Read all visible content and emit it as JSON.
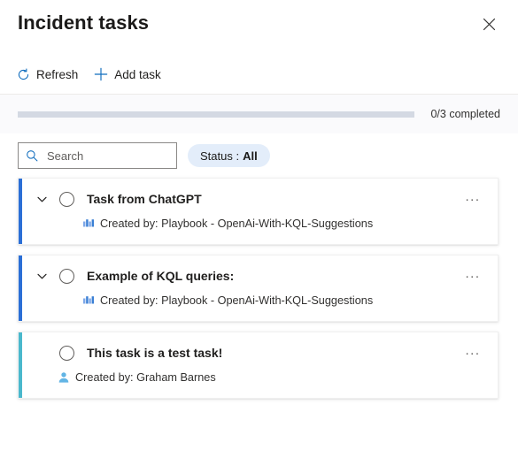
{
  "header": {
    "title": "Incident tasks",
    "close_label": "Close",
    "close_icon": "close-icon"
  },
  "command_bar": {
    "items": [
      {
        "label": "Refresh",
        "icon": "refresh-icon",
        "name": "refresh"
      },
      {
        "label": "Add task",
        "icon": "plus-icon",
        "name": "add-task"
      }
    ]
  },
  "progress": {
    "completed": 0,
    "total": 3,
    "percent": 0,
    "label": "0/3 completed",
    "track_color": "#d4d9e3",
    "fill_color": "#0f6cbd"
  },
  "filters": {
    "search": {
      "placeholder": "Search",
      "value": "",
      "icon": "search-icon"
    },
    "status_filter": {
      "label": "Status :",
      "value": "All",
      "background": "#e3edfa"
    }
  },
  "tasks": [
    {
      "title": "Task from ChatGPT",
      "created_by": "Created by: Playbook - OpenAi-With-KQL-Suggestions",
      "source_icon": "playbook-icon",
      "accent_color": "#2b6fd6",
      "has_chevron": true,
      "completed": false,
      "overflow_label": "..."
    },
    {
      "title": "Example of KQL queries:",
      "created_by": "Created by: Playbook - OpenAi-With-KQL-Suggestions",
      "source_icon": "playbook-icon",
      "accent_color": "#2b6fd6",
      "has_chevron": true,
      "completed": false,
      "overflow_label": "..."
    },
    {
      "title": "This task is a test task!",
      "created_by": "Created by: Graham Barnes",
      "source_icon": "person-icon",
      "accent_color": "#4ab8cc",
      "has_chevron": false,
      "completed": false,
      "overflow_label": "..."
    }
  ]
}
